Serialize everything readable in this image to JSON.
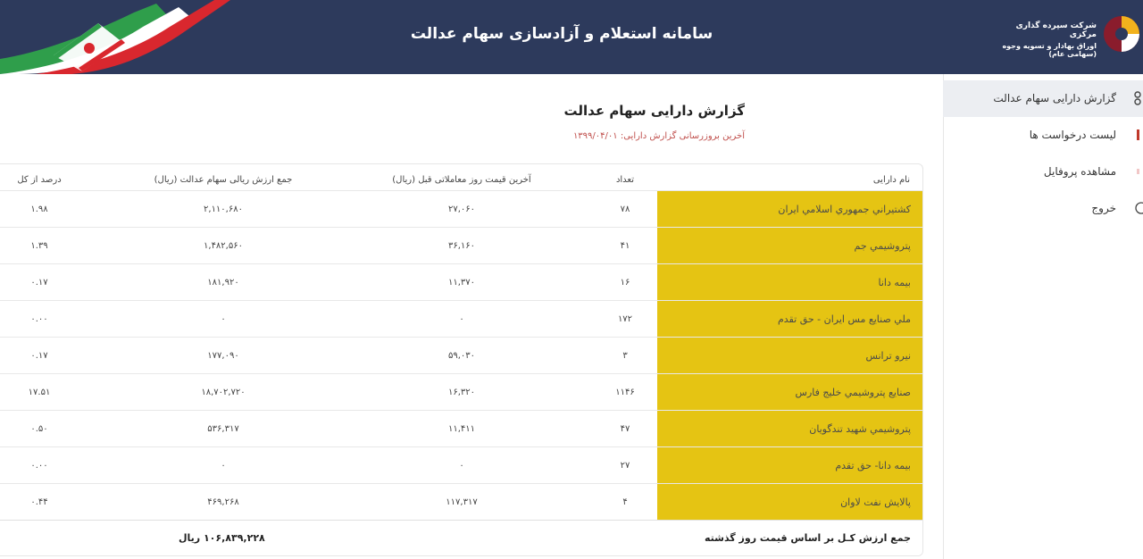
{
  "header": {
    "title": "سامانه استعلام و آزادسازی سهام عدالت",
    "logo_line1": "شرکت سپرده گذاری مرکزی",
    "logo_line2": "اوراق بهادار و تسویه وجوه (سهامی عام)"
  },
  "sidebar": {
    "items": [
      {
        "label": "گزارش دارایی سهام عدالت",
        "icon": "chart-icon",
        "active": true
      },
      {
        "label": "لیست درخواست ها",
        "icon": "list-icon",
        "active": false
      },
      {
        "label": "مشاهده پروفایل",
        "icon": "user-icon",
        "active": false
      },
      {
        "label": "خروج",
        "icon": "logout-icon",
        "active": false
      }
    ]
  },
  "report": {
    "title": "گزارش دارایی سهام عدالت",
    "subtitle": "آخرین بروزرسانی گزارش دارایی: ۱۳۹۹/۰۴/۰۱"
  },
  "table": {
    "headers": {
      "name": "نام دارایی",
      "count": "تعداد",
      "price": "آخرین قیمت روز معاملاتی قبل (ریال)",
      "value": "جمع ارزش ریالی سهام عدالت (ریال)",
      "percent": "درصد از کل"
    },
    "rows": [
      {
        "name": "کشتيراني جمهوري اسلامي ايران",
        "count": "۷۸",
        "price": "۲۷,۰۶۰",
        "value": "۲,۱۱۰,۶۸۰",
        "percent": "۱.۹۸"
      },
      {
        "name": "پتروشيمي جم",
        "count": "۴۱",
        "price": "۳۶,۱۶۰",
        "value": "۱,۴۸۲,۵۶۰",
        "percent": "۱.۳۹"
      },
      {
        "name": "بيمه دانا",
        "count": "۱۶",
        "price": "۱۱,۳۷۰",
        "value": "۱۸۱,۹۲۰",
        "percent": "۰.۱۷"
      },
      {
        "name": "ملي صنايع مس ايران - حق تقدم",
        "count": "۱۷۲",
        "price": "۰",
        "value": "۰",
        "percent": "۰.۰۰"
      },
      {
        "name": "نيرو ترانس",
        "count": "۳",
        "price": "۵۹,۰۳۰",
        "value": "۱۷۷,۰۹۰",
        "percent": "۰.۱۷"
      },
      {
        "name": "صنايع پتروشيمي خليج فارس",
        "count": "۱۱۴۶",
        "price": "۱۶,۳۲۰",
        "value": "۱۸,۷۰۲,۷۲۰",
        "percent": "۱۷.۵۱"
      },
      {
        "name": "پتروشيمي شهيد تندگويان",
        "count": "۴۷",
        "price": "۱۱,۴۱۱",
        "value": "۵۳۶,۳۱۷",
        "percent": "۰.۵۰"
      },
      {
        "name": "بيمه دانا- حق تقدم",
        "count": "۲۷",
        "price": "۰",
        "value": "۰",
        "percent": "۰.۰۰"
      },
      {
        "name": "پالايش نفت لاوان",
        "count": "۴",
        "price": "۱۱۷,۳۱۷",
        "value": "۴۶۹,۲۶۸",
        "percent": "۰.۴۴"
      }
    ],
    "total_label": "جمع ارزش کـل بر اساس قیمت روز گذشته",
    "total_value": "۱۰۶,۸۳۹,۲۲۸ ریال"
  },
  "colors": {
    "header_bg": "#2d3a5c",
    "name_cell_bg": "#e5c413",
    "subtitle": "#c0504d"
  }
}
